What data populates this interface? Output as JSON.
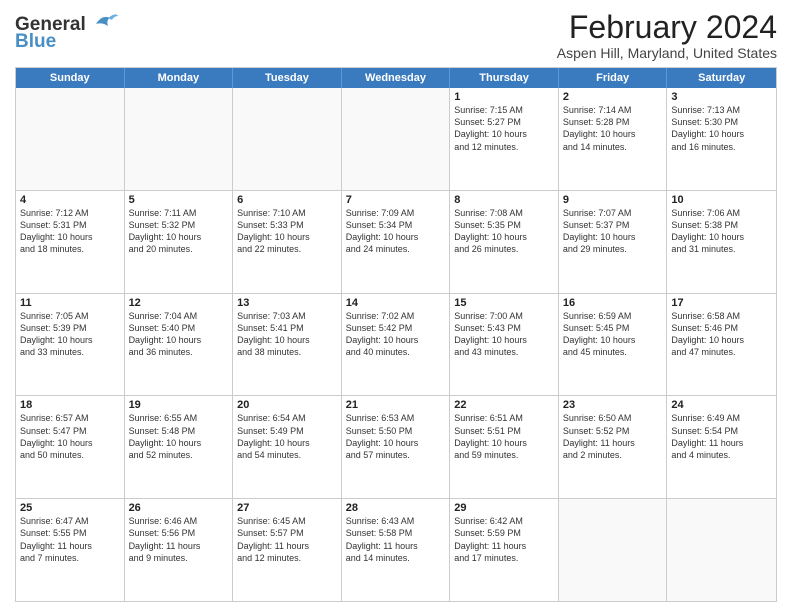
{
  "logo": {
    "line1": "General",
    "line2": "Blue"
  },
  "title": "February 2024",
  "subtitle": "Aspen Hill, Maryland, United States",
  "header_days": [
    "Sunday",
    "Monday",
    "Tuesday",
    "Wednesday",
    "Thursday",
    "Friday",
    "Saturday"
  ],
  "weeks": [
    [
      {
        "day": "",
        "info": "",
        "empty": true
      },
      {
        "day": "",
        "info": "",
        "empty": true
      },
      {
        "day": "",
        "info": "",
        "empty": true
      },
      {
        "day": "",
        "info": "",
        "empty": true
      },
      {
        "day": "1",
        "info": "Sunrise: 7:15 AM\nSunset: 5:27 PM\nDaylight: 10 hours\nand 12 minutes."
      },
      {
        "day": "2",
        "info": "Sunrise: 7:14 AM\nSunset: 5:28 PM\nDaylight: 10 hours\nand 14 minutes."
      },
      {
        "day": "3",
        "info": "Sunrise: 7:13 AM\nSunset: 5:30 PM\nDaylight: 10 hours\nand 16 minutes."
      }
    ],
    [
      {
        "day": "4",
        "info": "Sunrise: 7:12 AM\nSunset: 5:31 PM\nDaylight: 10 hours\nand 18 minutes."
      },
      {
        "day": "5",
        "info": "Sunrise: 7:11 AM\nSunset: 5:32 PM\nDaylight: 10 hours\nand 20 minutes."
      },
      {
        "day": "6",
        "info": "Sunrise: 7:10 AM\nSunset: 5:33 PM\nDaylight: 10 hours\nand 22 minutes."
      },
      {
        "day": "7",
        "info": "Sunrise: 7:09 AM\nSunset: 5:34 PM\nDaylight: 10 hours\nand 24 minutes."
      },
      {
        "day": "8",
        "info": "Sunrise: 7:08 AM\nSunset: 5:35 PM\nDaylight: 10 hours\nand 26 minutes."
      },
      {
        "day": "9",
        "info": "Sunrise: 7:07 AM\nSunset: 5:37 PM\nDaylight: 10 hours\nand 29 minutes."
      },
      {
        "day": "10",
        "info": "Sunrise: 7:06 AM\nSunset: 5:38 PM\nDaylight: 10 hours\nand 31 minutes."
      }
    ],
    [
      {
        "day": "11",
        "info": "Sunrise: 7:05 AM\nSunset: 5:39 PM\nDaylight: 10 hours\nand 33 minutes."
      },
      {
        "day": "12",
        "info": "Sunrise: 7:04 AM\nSunset: 5:40 PM\nDaylight: 10 hours\nand 36 minutes."
      },
      {
        "day": "13",
        "info": "Sunrise: 7:03 AM\nSunset: 5:41 PM\nDaylight: 10 hours\nand 38 minutes."
      },
      {
        "day": "14",
        "info": "Sunrise: 7:02 AM\nSunset: 5:42 PM\nDaylight: 10 hours\nand 40 minutes."
      },
      {
        "day": "15",
        "info": "Sunrise: 7:00 AM\nSunset: 5:43 PM\nDaylight: 10 hours\nand 43 minutes."
      },
      {
        "day": "16",
        "info": "Sunrise: 6:59 AM\nSunset: 5:45 PM\nDaylight: 10 hours\nand 45 minutes."
      },
      {
        "day": "17",
        "info": "Sunrise: 6:58 AM\nSunset: 5:46 PM\nDaylight: 10 hours\nand 47 minutes."
      }
    ],
    [
      {
        "day": "18",
        "info": "Sunrise: 6:57 AM\nSunset: 5:47 PM\nDaylight: 10 hours\nand 50 minutes."
      },
      {
        "day": "19",
        "info": "Sunrise: 6:55 AM\nSunset: 5:48 PM\nDaylight: 10 hours\nand 52 minutes."
      },
      {
        "day": "20",
        "info": "Sunrise: 6:54 AM\nSunset: 5:49 PM\nDaylight: 10 hours\nand 54 minutes."
      },
      {
        "day": "21",
        "info": "Sunrise: 6:53 AM\nSunset: 5:50 PM\nDaylight: 10 hours\nand 57 minutes."
      },
      {
        "day": "22",
        "info": "Sunrise: 6:51 AM\nSunset: 5:51 PM\nDaylight: 10 hours\nand 59 minutes."
      },
      {
        "day": "23",
        "info": "Sunrise: 6:50 AM\nSunset: 5:52 PM\nDaylight: 11 hours\nand 2 minutes."
      },
      {
        "day": "24",
        "info": "Sunrise: 6:49 AM\nSunset: 5:54 PM\nDaylight: 11 hours\nand 4 minutes."
      }
    ],
    [
      {
        "day": "25",
        "info": "Sunrise: 6:47 AM\nSunset: 5:55 PM\nDaylight: 11 hours\nand 7 minutes."
      },
      {
        "day": "26",
        "info": "Sunrise: 6:46 AM\nSunset: 5:56 PM\nDaylight: 11 hours\nand 9 minutes."
      },
      {
        "day": "27",
        "info": "Sunrise: 6:45 AM\nSunset: 5:57 PM\nDaylight: 11 hours\nand 12 minutes."
      },
      {
        "day": "28",
        "info": "Sunrise: 6:43 AM\nSunset: 5:58 PM\nDaylight: 11 hours\nand 14 minutes."
      },
      {
        "day": "29",
        "info": "Sunrise: 6:42 AM\nSunset: 5:59 PM\nDaylight: 11 hours\nand 17 minutes."
      },
      {
        "day": "",
        "info": "",
        "empty": true
      },
      {
        "day": "",
        "info": "",
        "empty": true
      }
    ]
  ]
}
